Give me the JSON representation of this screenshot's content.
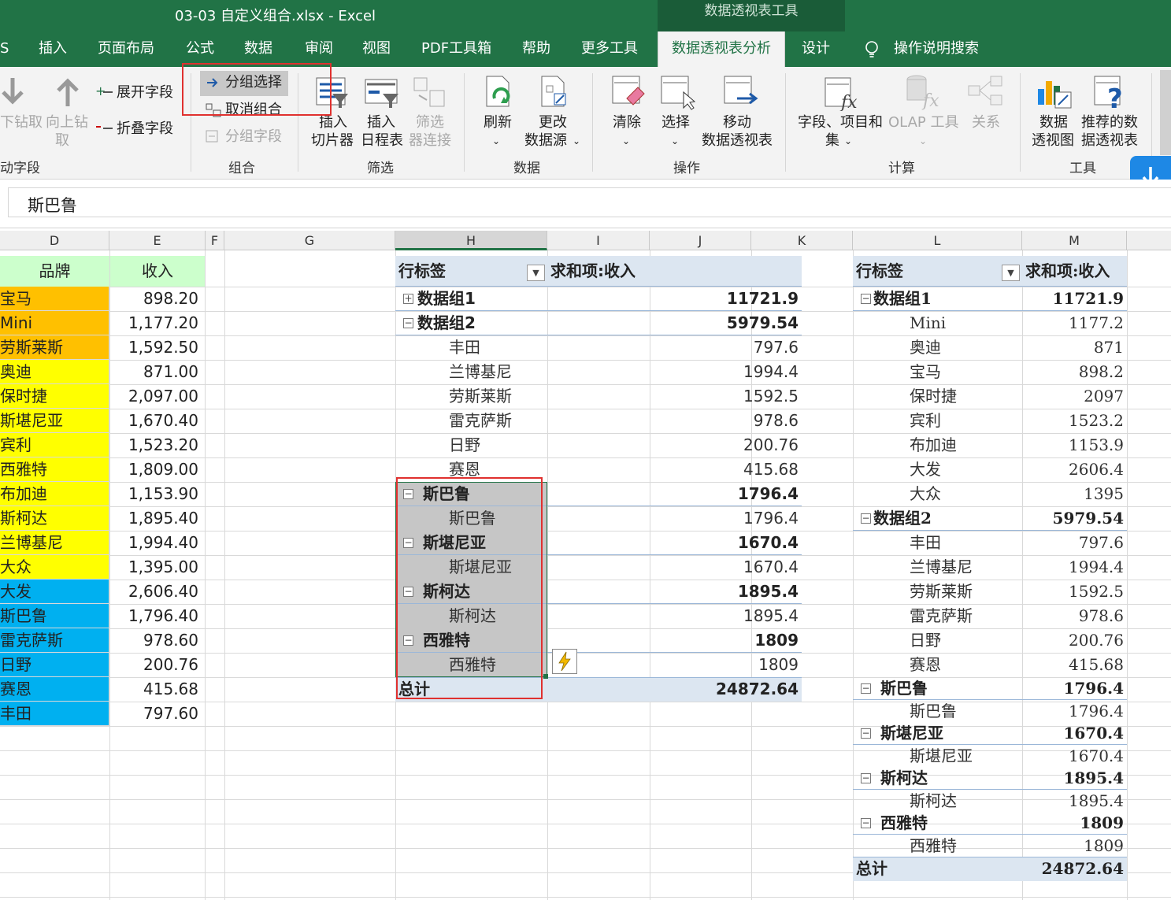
{
  "window": {
    "title": "03-03 自定义组合.xlsx  -  Excel",
    "context_tab": "数据透视表工具"
  },
  "tabs": [
    "S",
    "插入",
    "页面布局",
    "公式",
    "数据",
    "审阅",
    "视图",
    "PDF工具箱",
    "帮助",
    "更多工具",
    "数据透视表分析",
    "设计",
    "操作说明搜索"
  ],
  "ribbon": {
    "drill_down": "下钻取",
    "drill_up": "向上钻",
    "drill_up2": "取",
    "expand": "展开字段",
    "collapse": "折叠字段",
    "grp_active": "动字段",
    "group_selection": "分组选择",
    "ungroup": "取消组合",
    "group_field": "分组字段",
    "grp_group": "组合",
    "slicer1": "插入",
    "slicer2": "切片器",
    "timeline1": "插入",
    "timeline2": "日程表",
    "filter1": "筛选",
    "filter2": "器连接",
    "grp_filter": "筛选",
    "refresh": "刷新",
    "change1": "更改",
    "change2": "数据源",
    "grp_data": "数据",
    "clear": "清除",
    "select": "选择",
    "move1": "移动",
    "move2": "数据透视表",
    "grp_actions": "操作",
    "fields1": "字段、项目和",
    "fields2": "集",
    "olap": "OLAP 工具",
    "rel": "关系",
    "grp_calc": "计算",
    "pchart1": "数据",
    "pchart2": "透视图",
    "rec1": "推荐的数",
    "rec2": "据透视表",
    "grp_tools": "工具"
  },
  "formula_bar": {
    "value": "斯巴鲁"
  },
  "columns": [
    "D",
    "E",
    "F",
    "G",
    "H",
    "I",
    "J",
    "K",
    "L",
    "M"
  ],
  "source": {
    "header_brand": "品牌",
    "header_income": "收入",
    "rows": [
      [
        "宝马",
        "898.20",
        "orange"
      ],
      [
        "Mini",
        "1,177.20",
        "orange"
      ],
      [
        "劳斯莱斯",
        "1,592.50",
        "orange"
      ],
      [
        "奥迪",
        "871.00",
        "yellow"
      ],
      [
        "保时捷",
        "2,097.00",
        "yellow"
      ],
      [
        "斯堪尼亚",
        "1,670.40",
        "yellow"
      ],
      [
        "宾利",
        "1,523.20",
        "yellow"
      ],
      [
        "西雅特",
        "1,809.00",
        "yellow"
      ],
      [
        "布加迪",
        "1,153.90",
        "yellow"
      ],
      [
        "斯柯达",
        "1,895.40",
        "yellow"
      ],
      [
        "兰博基尼",
        "1,994.40",
        "yellow"
      ],
      [
        "大众",
        "1,395.00",
        "yellow"
      ],
      [
        "大发",
        "2,606.40",
        "blue"
      ],
      [
        "斯巴鲁",
        "1,796.40",
        "blue"
      ],
      [
        "雷克萨斯",
        "978.60",
        "blue"
      ],
      [
        "日野",
        "200.76",
        "blue"
      ],
      [
        "赛恩",
        "415.68",
        "blue"
      ],
      [
        "丰田",
        "797.60",
        "blue"
      ]
    ]
  },
  "colors": {
    "orange": "#ffc000",
    "yellow": "#ffff00",
    "blue": "#00b0f0",
    "header_green": "#ccffcc",
    "pivot_header": "#dce6f1",
    "excel_green": "#217346"
  },
  "pivot1": {
    "h1": "行标签",
    "h2": "求和项:收入",
    "rows": [
      [
        "+",
        "数据组1",
        "11721.9",
        1
      ],
      [
        "-",
        "数据组2",
        "5979.54",
        1
      ],
      [
        "",
        "丰田",
        "797.6",
        2
      ],
      [
        "",
        "兰博基尼",
        "1994.4",
        2
      ],
      [
        "",
        "劳斯莱斯",
        "1592.5",
        2
      ],
      [
        "",
        "雷克萨斯",
        "978.6",
        2
      ],
      [
        "",
        "日野",
        "200.76",
        2
      ],
      [
        "",
        "赛恩",
        "415.68",
        2
      ],
      [
        "-",
        "斯巴鲁",
        "1796.4",
        1
      ],
      [
        "",
        "斯巴鲁",
        "1796.4",
        2
      ],
      [
        "-",
        "斯堪尼亚",
        "1670.4",
        1
      ],
      [
        "",
        "斯堪尼亚",
        "1670.4",
        2
      ],
      [
        "-",
        "斯柯达",
        "1895.4",
        1
      ],
      [
        "",
        "斯柯达",
        "1895.4",
        2
      ],
      [
        "-",
        "西雅特",
        "1809",
        1
      ],
      [
        "",
        "西雅特",
        "1809",
        2
      ]
    ],
    "total_label": "总计",
    "total": "24872.64"
  },
  "pivot2": {
    "h1": "行标签",
    "h2": "求和项:收入",
    "rows": [
      [
        "-",
        "数据组1",
        "11721.9",
        1
      ],
      [
        "",
        "Mini",
        "1177.2",
        2
      ],
      [
        "",
        "奥迪",
        "871",
        2
      ],
      [
        "",
        "宝马",
        "898.2",
        2
      ],
      [
        "",
        "保时捷",
        "2097",
        2
      ],
      [
        "",
        "宾利",
        "1523.2",
        2
      ],
      [
        "",
        "布加迪",
        "1153.9",
        2
      ],
      [
        "",
        "大发",
        "2606.4",
        2
      ],
      [
        "",
        "大众",
        "1395",
        2
      ],
      [
        "-",
        "数据组2",
        "5979.54",
        1
      ],
      [
        "",
        "丰田",
        "797.6",
        2
      ],
      [
        "",
        "兰博基尼",
        "1994.4",
        2
      ],
      [
        "",
        "劳斯莱斯",
        "1592.5",
        2
      ],
      [
        "",
        "雷克萨斯",
        "978.6",
        2
      ],
      [
        "",
        "日野",
        "200.76",
        2
      ],
      [
        "",
        "赛恩",
        "415.68",
        2
      ],
      [
        "-",
        "斯巴鲁",
        "1796.4",
        1
      ],
      [
        "",
        "斯巴鲁",
        "1796.4",
        2
      ],
      [
        "-",
        "斯堪尼亚",
        "1670.4",
        1
      ],
      [
        "",
        "斯堪尼亚",
        "1670.4",
        2
      ],
      [
        "-",
        "斯柯达",
        "1895.4",
        1
      ],
      [
        "",
        "斯柯达",
        "1895.4",
        2
      ],
      [
        "-",
        "西雅特",
        "1809",
        1
      ],
      [
        "",
        "西雅特",
        "1809",
        2
      ]
    ],
    "total_label": "总计",
    "total": "24872.64"
  }
}
